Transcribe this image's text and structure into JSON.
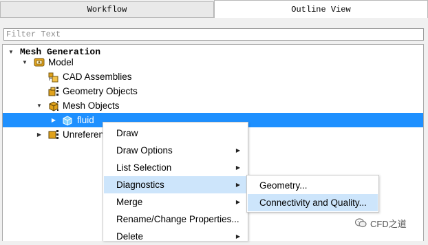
{
  "tabs": [
    {
      "label": "Workflow"
    },
    {
      "label": "Outline View"
    }
  ],
  "filter": {
    "placeholder": "Filter Text",
    "value": ""
  },
  "tree": {
    "root": "Mesh Generation",
    "model": "Model",
    "cad_assemblies": "CAD Assemblies",
    "geometry_objects": "Geometry Objects",
    "mesh_objects": "Mesh Objects",
    "fluid": "fluid",
    "unreferenced": "Unreferen"
  },
  "context_menu": {
    "items": [
      {
        "label": "Draw",
        "submenu": false
      },
      {
        "label": "Draw Options",
        "submenu": true
      },
      {
        "label": "List Selection",
        "submenu": true
      },
      {
        "label": "Diagnostics",
        "submenu": true
      },
      {
        "label": "Merge",
        "submenu": true
      },
      {
        "label": "Rename/Change Properties...",
        "submenu": false
      },
      {
        "label": "Delete",
        "submenu": true
      }
    ],
    "highlighted": "Diagnostics"
  },
  "submenu": {
    "items": [
      {
        "label": "Geometry..."
      },
      {
        "label": "Connectivity and Quality..."
      }
    ],
    "highlighted": "Connectivity and Quality..."
  },
  "watermark": {
    "text": "CFD之道"
  },
  "colors": {
    "selection": "#1e90ff",
    "menu_hover": "#cde5fb",
    "icon_gold": "#e0a21c"
  }
}
